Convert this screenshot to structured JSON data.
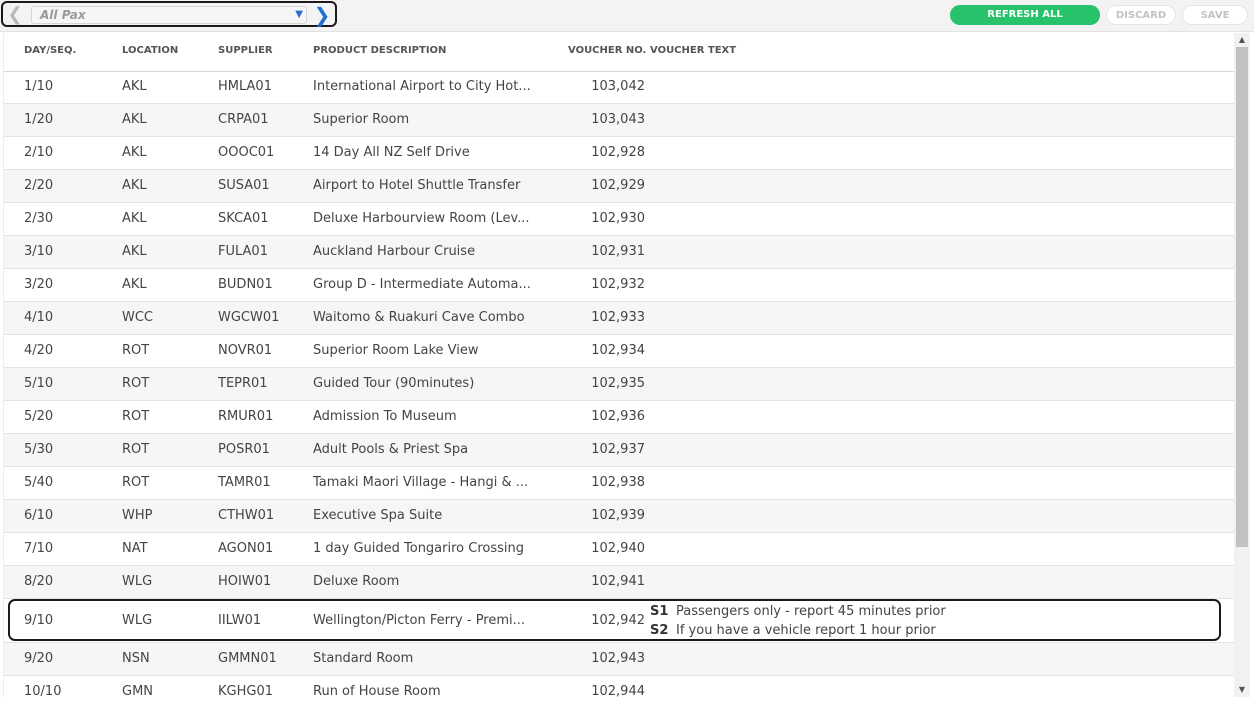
{
  "toolbar": {
    "pax_value": "All Pax",
    "refresh_label": "REFRESH ALL",
    "discard_label": "DISCARD",
    "save_label": "SAVE",
    "accent_color": "#27c26a",
    "nav_color": "#1f6fd1"
  },
  "table": {
    "columns": [
      "DAY/SEQ.",
      "LOCATION",
      "SUPPLIER",
      "PRODUCT DESCRIPTION",
      "VOUCHER NO.",
      "VOUCHER TEXT"
    ],
    "rows": [
      {
        "day": "1/10",
        "location": "AKL",
        "supplier": "HMLA01",
        "description": "International Airport to City Hot...",
        "voucher": "103,042"
      },
      {
        "day": "1/20",
        "location": "AKL",
        "supplier": "CRPA01",
        "description": "Superior Room",
        "voucher": "103,043"
      },
      {
        "day": "2/10",
        "location": "AKL",
        "supplier": "OOOC01",
        "description": "14 Day All NZ Self Drive",
        "voucher": "102,928"
      },
      {
        "day": "2/20",
        "location": "AKL",
        "supplier": "SUSA01",
        "description": "Airport to Hotel Shuttle Transfer",
        "voucher": "102,929"
      },
      {
        "day": "2/30",
        "location": "AKL",
        "supplier": "SKCA01",
        "description": "Deluxe Harbourview Room (Lev...",
        "voucher": "102,930"
      },
      {
        "day": "3/10",
        "location": "AKL",
        "supplier": "FULA01",
        "description": "Auckland Harbour Cruise",
        "voucher": "102,931"
      },
      {
        "day": "3/20",
        "location": "AKL",
        "supplier": "BUDN01",
        "description": "Group D - Intermediate Automa...",
        "voucher": "102,932"
      },
      {
        "day": "4/10",
        "location": "WCC",
        "supplier": "WGCW01",
        "description": "Waitomo & Ruakuri Cave Combo",
        "voucher": "102,933"
      },
      {
        "day": "4/20",
        "location": "ROT",
        "supplier": "NOVR01",
        "description": "Superior Room Lake View",
        "voucher": "102,934"
      },
      {
        "day": "5/10",
        "location": "ROT",
        "supplier": "TEPR01",
        "description": "Guided Tour (90minutes)",
        "voucher": "102,935"
      },
      {
        "day": "5/20",
        "location": "ROT",
        "supplier": "RMUR01",
        "description": "Admission To Museum",
        "voucher": "102,936"
      },
      {
        "day": "5/30",
        "location": "ROT",
        "supplier": "POSR01",
        "description": "Adult Pools & Priest Spa",
        "voucher": "102,937"
      },
      {
        "day": "5/40",
        "location": "ROT",
        "supplier": "TAMR01",
        "description": "Tamaki Maori Village - Hangi & ...",
        "voucher": "102,938"
      },
      {
        "day": "6/10",
        "location": "WHP",
        "supplier": "CTHW01",
        "description": "Executive Spa Suite",
        "voucher": "102,939"
      },
      {
        "day": "7/10",
        "location": "NAT",
        "supplier": "AGON01",
        "description": "1 day Guided Tongariro Crossing",
        "voucher": "102,940"
      },
      {
        "day": "8/20",
        "location": "WLG",
        "supplier": "HOIW01",
        "description": "Deluxe Room",
        "voucher": "102,941"
      },
      {
        "day": "9/10",
        "location": "WLG",
        "supplier": "IILW01",
        "description": "Wellington/Picton Ferry - Premi...",
        "voucher": "102,942",
        "voucher_text": [
          {
            "code": "S1",
            "text": "Passengers only - report 45 minutes prior"
          },
          {
            "code": "S2",
            "text": "If you have a vehicle report 1 hour prior"
          }
        ]
      },
      {
        "day": "9/20",
        "location": "NSN",
        "supplier": "GMMN01",
        "description": "Standard Room",
        "voucher": "102,943"
      },
      {
        "day": "10/10",
        "location": "GMN",
        "supplier": "KGHG01",
        "description": "Run of House Room",
        "voucher": "102,944"
      }
    ]
  }
}
